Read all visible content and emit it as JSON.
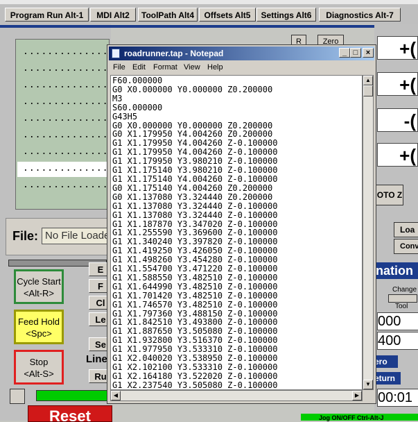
{
  "tabs": [
    {
      "label": "Program Run Alt-1"
    },
    {
      "label": "MDI Alt2"
    },
    {
      "label": "ToolPath Alt4"
    },
    {
      "label": "Offsets Alt5"
    },
    {
      "label": "Settings Alt6"
    },
    {
      "label": "Diagnostics Alt-7"
    }
  ],
  "dro_rows": [
    "..............",
    "..............",
    "..............",
    "..............",
    "..............",
    "..............",
    "..............",
    "..............",
    ".............."
  ],
  "file": {
    "label": "File:",
    "value": "No File Loaded"
  },
  "controls": {
    "cycle_start": [
      "Cycle Start",
      "<Alt-R>"
    ],
    "feed_hold": [
      "Feed Hold",
      "<Spc>"
    ],
    "stop": [
      "Stop",
      "<Alt-S>"
    ],
    "reset": "Reset",
    "jog": "Jog ON/OFF Ctrl-Alt-J"
  },
  "left_partial": [
    "E",
    "F",
    "Cl",
    "Le",
    "Se",
    "Ru",
    "Line"
  ],
  "right_partial": {
    "r": "R",
    "zero": "Zero",
    "dro": [
      "+(",
      "+(",
      "-(",
      "+("
    ],
    "goto_z": "OTO Z",
    "load": "Loa",
    "conv": "Conv",
    "nation": "nation",
    "change": "Change",
    "tool": "Tool",
    "dro2": [
      "000",
      "400"
    ],
    "zero2": "ero",
    "return": "eturn",
    "time": "00:01"
  },
  "notepad": {
    "title": "roadrunner.tap - Notepad",
    "menu": [
      "File",
      "Edit",
      "Format",
      "View",
      "Help"
    ],
    "lines": [
      "F60.000000",
      "G0 X0.000000 Y0.000000 Z0.200000",
      "M3",
      "S60.000000",
      "G43H5",
      "G0 X0.000000 Y0.000000 Z0.200000",
      "G0 X1.179950 Y4.004260 Z0.200000",
      "G1 X1.179950 Y4.004260 Z-0.100000",
      "G1 X1.179950 Y4.004260 Z-0.100000",
      "G1 X1.179950 Y3.980210 Z-0.100000",
      "G1 X1.175140 Y3.980210 Z-0.100000",
      "G1 X1.175140 Y4.004260 Z-0.100000",
      "G0 X1.175140 Y4.004260 Z0.200000",
      "G0 X1.137080 Y3.324440 Z0.200000",
      "G1 X1.137080 Y3.324440 Z-0.100000",
      "G1 X1.137080 Y3.324440 Z-0.100000",
      "G1 X1.187870 Y3.347020 Z-0.100000",
      "G1 X1.255590 Y3.369600 Z-0.100000",
      "G1 X1.340240 Y3.397820 Z-0.100000",
      "G1 X1.419250 Y3.426050 Z-0.100000",
      "G1 X1.498260 Y3.454280 Z-0.100000",
      "G1 X1.554700 Y3.471220 Z-0.100000",
      "G1 X1.588550 Y3.482510 Z-0.100000",
      "G1 X1.644990 Y3.482510 Z-0.100000",
      "G1 X1.701420 Y3.482510 Z-0.100000",
      "G1 X1.746570 Y3.482510 Z-0.100000",
      "G1 X1.797360 Y3.488150 Z-0.100000",
      "G1 X1.842510 Y3.493800 Z-0.100000",
      "G1 X1.887650 Y3.505080 Z-0.100000",
      "G1 X1.932800 Y3.516370 Z-0.100000",
      "G1 X1.977950 Y3.533310 Z-0.100000",
      "G1 X2.040020 Y3.538950 Z-0.100000",
      "G1 X2.102100 Y3.533310 Z-0.100000",
      "G1 X2.164180 Y3.522020 Z-0.100000",
      "G1 X2.237540 Y3.505080 Z-0.100000"
    ]
  },
  "colors": {
    "titlebar": "#0a246a",
    "cycle_start": "#2e8b3a",
    "feed_hold": "#e8e800",
    "stop": "#e02020",
    "reset": "#d01818"
  }
}
